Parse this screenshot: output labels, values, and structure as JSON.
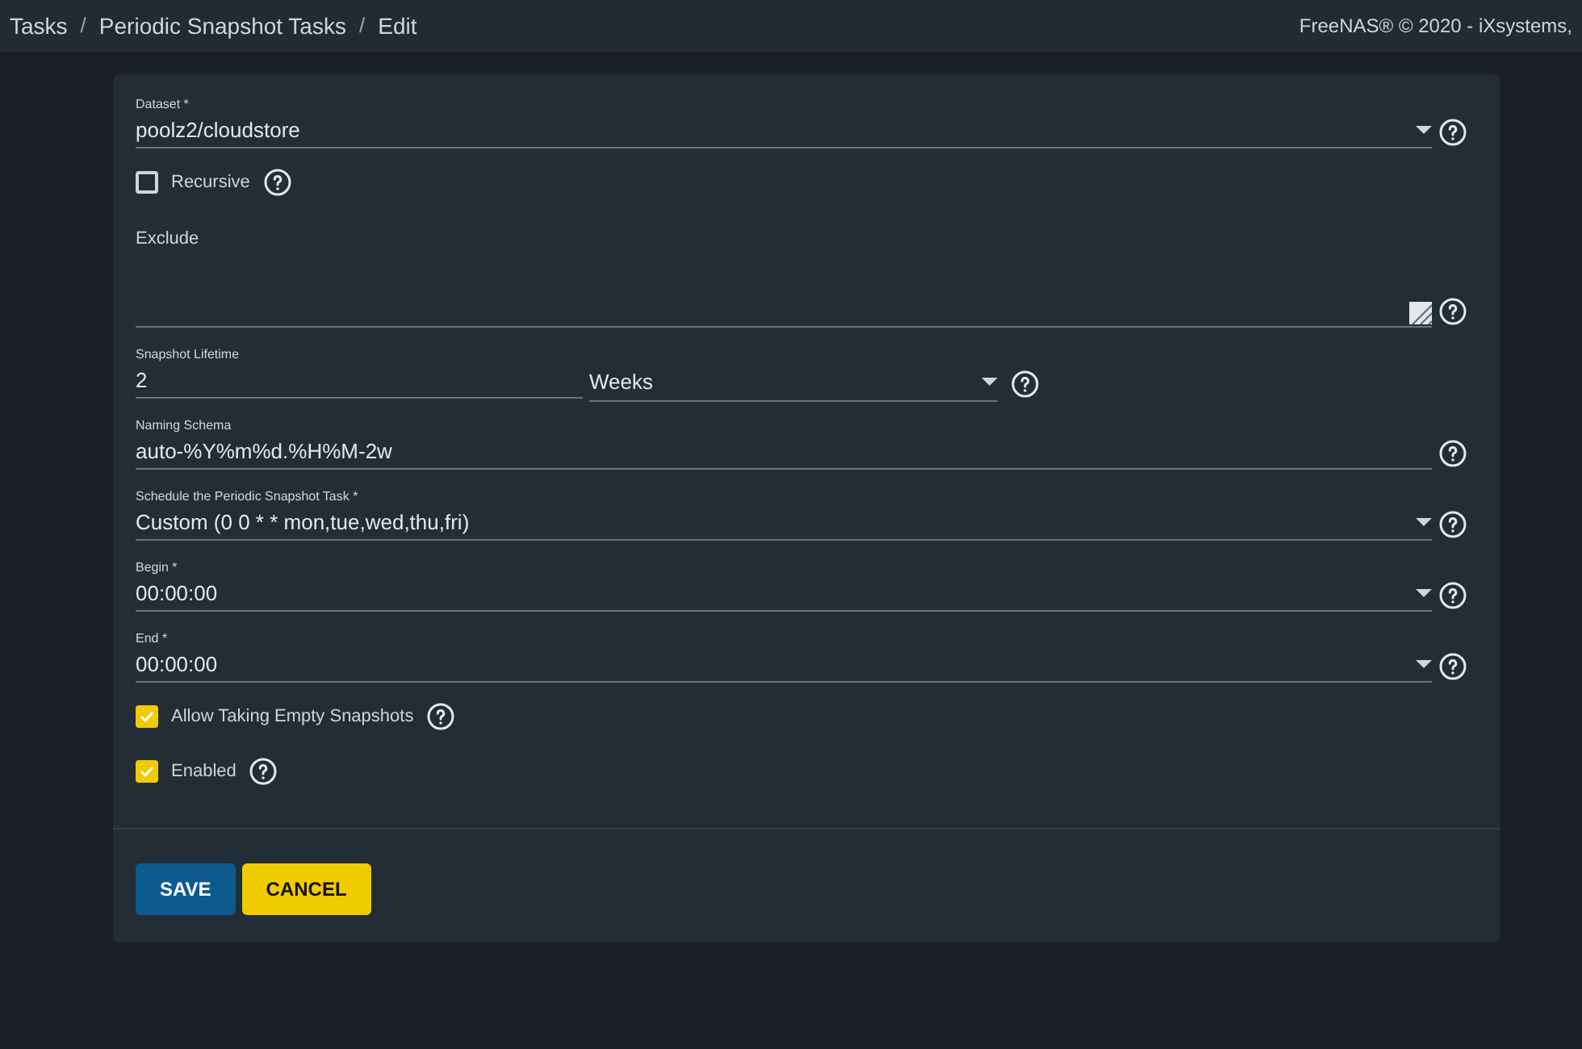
{
  "breadcrumbs": [
    "Tasks",
    "Periodic Snapshot Tasks",
    "Edit"
  ],
  "breadcrumb_separators": [
    "/",
    "/"
  ],
  "copyright": "FreeNAS® © 2020 - iXsystems,",
  "fields": [
    {
      "kind": "select",
      "label": "Dataset *",
      "value": "poolz2/cloudstore"
    },
    {
      "kind": "checkbox",
      "label": "Recursive",
      "checked": false
    },
    {
      "kind": "textarea",
      "label": "Exclude"
    },
    {
      "kind": "lifetime",
      "label": "Snapshot Lifetime",
      "value": "2",
      "unit": "Weeks"
    },
    {
      "kind": "text",
      "label": "Naming Schema",
      "value": "auto-%Y%m%d.%H%M-2w"
    },
    {
      "kind": "select",
      "label": "Schedule the Periodic Snapshot Task *",
      "value": "Custom (0 0 * * mon,tue,wed,thu,fri)"
    },
    {
      "kind": "select",
      "label": "Begin *",
      "value": "00:00:00"
    },
    {
      "kind": "select",
      "label": "End *",
      "value": "00:00:00"
    },
    {
      "kind": "checkbox",
      "label": "Allow Taking Empty Snapshots",
      "checked": true
    },
    {
      "kind": "checkbox",
      "label": "Enabled",
      "checked": true
    }
  ],
  "buttons": [
    {
      "kind": "primary",
      "label": "SAVE"
    },
    {
      "kind": "warning",
      "label": "CANCEL"
    }
  ]
}
